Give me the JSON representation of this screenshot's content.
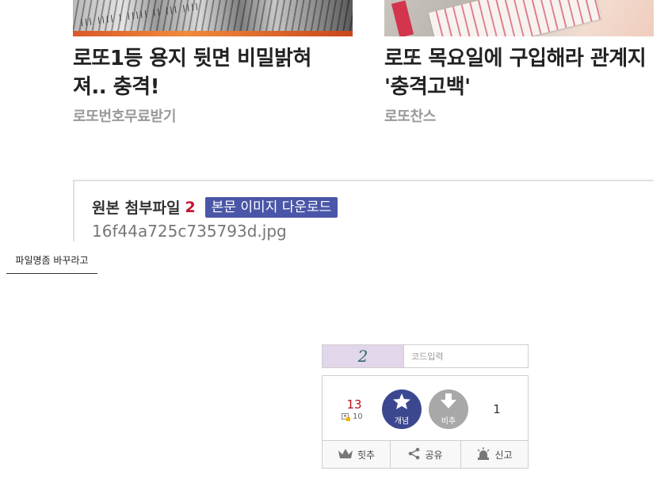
{
  "articles": [
    {
      "title_line1": "로또1등 용지 뒷면 비밀밝혀",
      "title_line2": "져.. 충격!",
      "source": "로또번호무료받기"
    },
    {
      "title_line1": "로또 목요일에 구입해라 관계지",
      "title_line2": "'충격고백'",
      "source": "로또찬스"
    }
  ],
  "attachment": {
    "label": "원본 첨부파일",
    "count": "2",
    "download_label": "본문 이미지 다운로드",
    "filename": "16f44a725c735793d.jpg"
  },
  "rename_label": "파일명좀 바꾸라고",
  "captcha": {
    "image_text": "2",
    "placeholder": "코드입력",
    "image_color": "#e2d6ea"
  },
  "vote": {
    "up_count": "13",
    "fixed_count": "10",
    "up_label": "개념",
    "down_label": "비추",
    "down_count": "1",
    "up_color": "#3b4890",
    "down_color": "#a8a8a8"
  },
  "footer": {
    "hit_label": "힛추",
    "share_label": "공유",
    "report_label": "신고"
  }
}
